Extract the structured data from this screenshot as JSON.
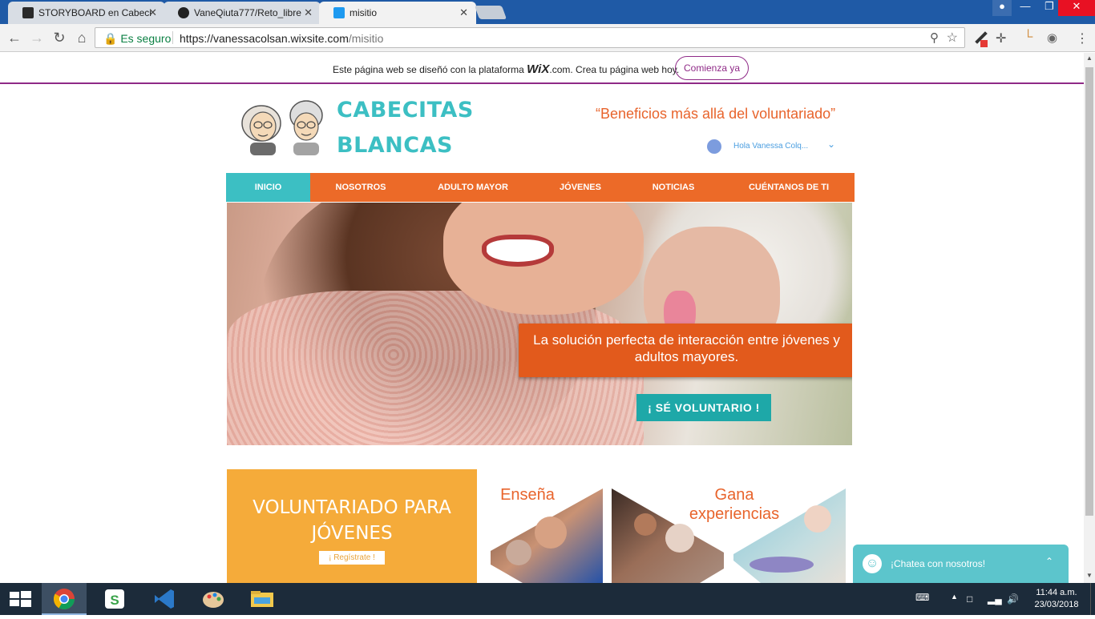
{
  "browser": {
    "tabs": [
      {
        "label": "STORYBOARD en Cabeci",
        "close": "✕"
      },
      {
        "label": "VaneQiuta777/Reto_libre",
        "close": "✕"
      },
      {
        "label": "misitio",
        "close": "✕"
      }
    ],
    "security_label": "Es seguro",
    "url_host": "https://vanessacolsan.wixsite.com",
    "url_path": "/misitio"
  },
  "wix_banner": {
    "text_before": "Este página web se diseñó con la plataforma ",
    "logo": "WiX",
    "text_after": ".com. Crea tu página web hoy.",
    "button": "Comienza ya"
  },
  "site": {
    "brand_line1": "CABECITAS",
    "brand_line2": "BLANCAS",
    "slogan": "“Beneficios más allá del voluntariado”",
    "user_greeting": "Hola Vanessa Colq...",
    "nav": [
      "INICIO",
      "NOSOTROS",
      "ADULTO MAYOR",
      "JÓVENES",
      "NOTICIAS",
      "CUÉNTANOS DE TI"
    ],
    "hero": {
      "caption": "La solución perfecta de interacción entre jóvenes y adultos mayores.",
      "cta": "¡ SÉ VOLUNTARIO !"
    },
    "youth": {
      "title_line1": "VOLUNTARIADO PARA",
      "title_line2": "JÓVENES",
      "button": "¡ Regístrate !"
    },
    "teach_title": "Enseña",
    "gain_title_line1": "Gana",
    "gain_title_line2": "experiencias",
    "chat_label": "¡Chatea con nosotros!"
  },
  "taskbar": {
    "time": "11:44 a.m.",
    "date": "23/03/2018"
  },
  "colors": {
    "accent_orange": "#ec6a28",
    "accent_teal": "#3cbfc3",
    "wix_purple": "#8f2a87",
    "youth_yellow": "#f5ab3a"
  }
}
